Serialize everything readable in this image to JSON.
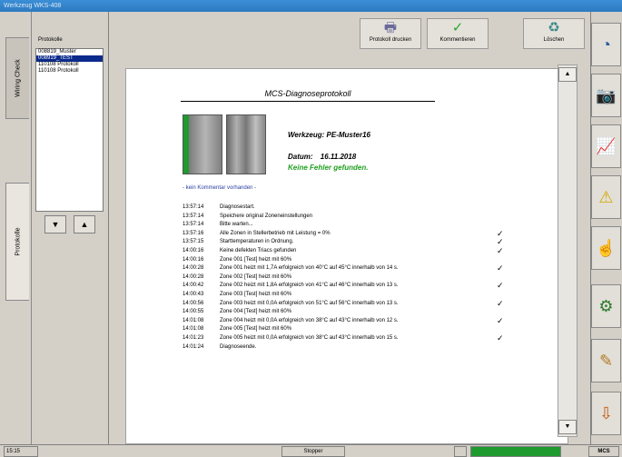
{
  "window_title": "Werkzeug WKS-408",
  "left_tabs": [
    "Wiring Check",
    "Protokolle"
  ],
  "left_panel": {
    "label": "Protokolle",
    "items": [
      "008819_Muster",
      "008919_TEST",
      "110108 Protokoll",
      "110108 Protokoll"
    ],
    "up_arrow": "▲",
    "down_arrow": "▼"
  },
  "toolbar": {
    "print_label": "Protokoll drucken",
    "confirm_label": "Kommentieren",
    "delete_label": "Löschen"
  },
  "document": {
    "title": "MCS-Diagnoseprotokoll",
    "werkzeug_label": "Werkzeug:",
    "werkzeug_value": "PE-Muster16",
    "datum_label": "Datum:",
    "datum_value": "16.11.2018",
    "result": "Keine Fehler gefunden.",
    "comment": "- kein Kommentar vorhanden -",
    "log": [
      {
        "time": "13:57:14",
        "msg": "Diagnosestart.",
        "check": ""
      },
      {
        "time": "13:57:14",
        "msg": "Speichere original Zoneneinstellungen",
        "check": ""
      },
      {
        "time": "13:57:14",
        "msg": "Bitte warten...",
        "check": ""
      },
      {
        "time": "13:57:16",
        "msg": "Alle Zonen in Stellerbetrieb mit Leistung = 0%",
        "check": "✓"
      },
      {
        "time": "13:57:15",
        "msg": "Starttemperaturen in Ordnung.",
        "check": "✓"
      },
      {
        "time": "14:00:16",
        "msg": "Keine defekten Triacs gefunden",
        "check": "✓"
      },
      {
        "time": "14:00:16",
        "msg": "Zone 001 [Test] heizt mit 60%",
        "check": ""
      },
      {
        "time": "14:00:28",
        "msg": "Zone 001 heizt mit 1,7A erfolgreich von 40°C auf 45°C innerhalb von 14 s.",
        "check": "✓"
      },
      {
        "time": "14:00:28",
        "msg": "Zone 002 [Test] heizt mit 60%",
        "check": ""
      },
      {
        "time": "14:00:42",
        "msg": "Zone 002 heizt mit 1,8A erfolgreich von 41°C auf 46°C innerhalb von 13 s.",
        "check": "✓"
      },
      {
        "time": "14:00:43",
        "msg": "Zone 003 [Test] heizt mit 60%",
        "check": ""
      },
      {
        "time": "14:00:56",
        "msg": "Zone 003 heizt mit 0,0A erfolgreich von 51°C auf 56°C innerhalb von 13 s.",
        "check": "✓"
      },
      {
        "time": "14:00:55",
        "msg": "Zone 004 [Test] heizt mit 60%",
        "check": ""
      },
      {
        "time": "14:01:08",
        "msg": "Zone 004 heizt mit 0,0A erfolgreich von 38°C auf 43°C innerhalb von 12 s.",
        "check": "✓"
      },
      {
        "time": "14:01:08",
        "msg": "Zone 005 [Test] heizt mit 60%",
        "check": ""
      },
      {
        "time": "14:01:23",
        "msg": "Zone 005 heizt mit 0,0A erfolgreich von 38°C auf 43°C innerhalb von 15 s.",
        "check": "✓"
      },
      {
        "time": "14:01:24",
        "msg": "Diagnoseende.",
        "check": ""
      }
    ]
  },
  "scroll": {
    "up": "▲",
    "down": "▼"
  },
  "statusbar": {
    "time": "15:15",
    "mode": "Stopper",
    "brand": "MCS"
  },
  "colors": {
    "titlebar": "#3b8fd6",
    "ok_green": "#22a022",
    "selection": "#0a2a8c",
    "status_green": "#1e9a2e"
  }
}
